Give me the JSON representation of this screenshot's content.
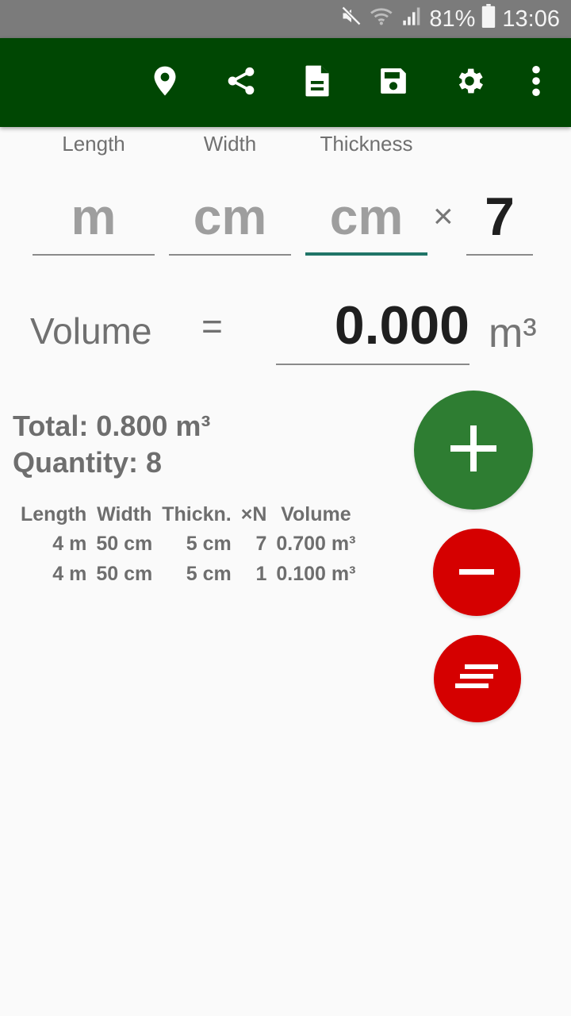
{
  "status_bar": {
    "battery_percent": "81%",
    "time": "13:06",
    "icons": [
      "mute-icon",
      "wifi-icon",
      "signal-icon",
      "battery-icon"
    ]
  },
  "toolbar": {
    "actions": [
      {
        "name": "location",
        "icon": "location-pin-icon"
      },
      {
        "name": "share",
        "icon": "share-icon"
      },
      {
        "name": "document",
        "icon": "document-icon"
      },
      {
        "name": "save",
        "icon": "save-icon"
      },
      {
        "name": "settings",
        "icon": "gear-icon"
      },
      {
        "name": "more",
        "icon": "more-vert-icon"
      }
    ]
  },
  "inputs": {
    "length": {
      "label": "Length",
      "placeholder": "m",
      "value": ""
    },
    "width": {
      "label": "Width",
      "placeholder": "cm",
      "value": ""
    },
    "thickness": {
      "label": "Thickness",
      "placeholder": "cm",
      "value": ""
    },
    "times_symbol": "×",
    "quantity": {
      "value": "7"
    }
  },
  "volume": {
    "label": "Volume",
    "equals": "=",
    "value": "0.000",
    "unit": "m³"
  },
  "summary": {
    "total": "Total: 0.800 m³",
    "quantity": "Quantity: 8"
  },
  "table": {
    "headers": [
      "Length",
      "Width",
      "Thickn.",
      "×N",
      "Volume"
    ],
    "rows": [
      [
        "4 m",
        "50 cm",
        "5 cm",
        "7",
        "0.700 m³"
      ],
      [
        "4 m",
        "50 cm",
        "5 cm",
        "1",
        "0.100 m³"
      ]
    ]
  },
  "buttons": {
    "add": {
      "icon": "plus-icon",
      "color": "#2e7d32"
    },
    "remove": {
      "icon": "minus-icon",
      "color": "#d50000"
    },
    "clear": {
      "icon": "clear-list-icon",
      "color": "#d50000"
    }
  },
  "colors": {
    "toolbar": "#004703",
    "status_bar": "#7b7b7b",
    "active_underline": "#207568"
  }
}
